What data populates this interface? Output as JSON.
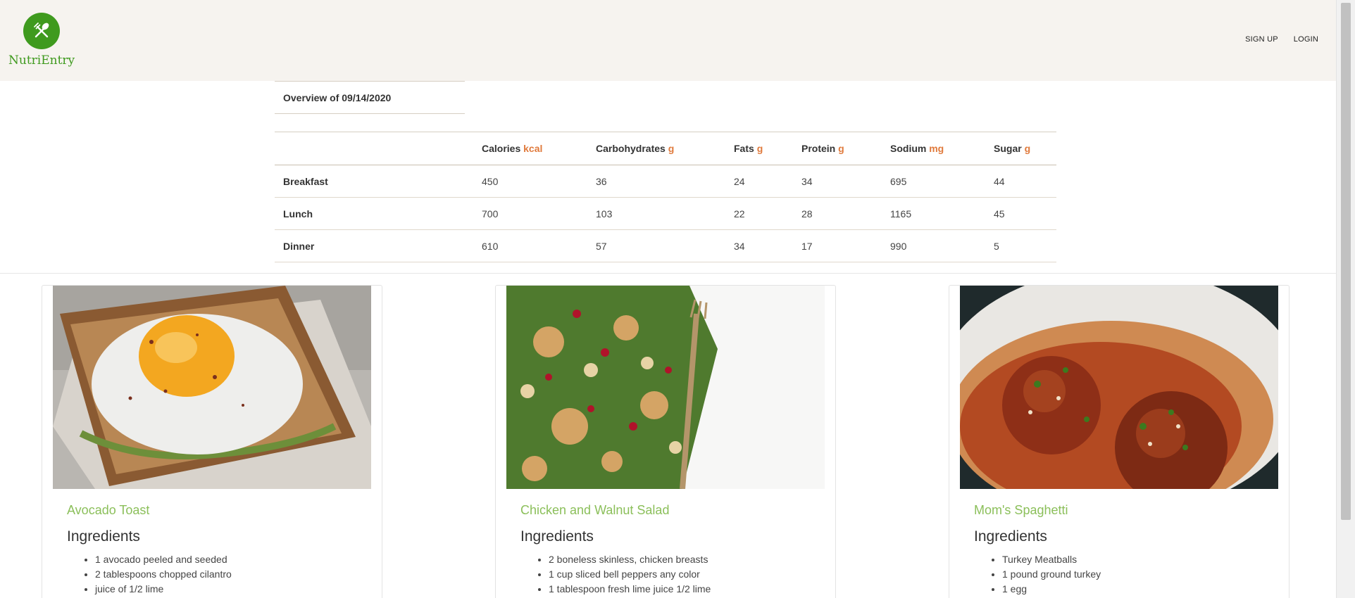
{
  "header": {
    "brand": "NutriEntry",
    "nav": [
      "SIGN UP",
      "LOGIN"
    ]
  },
  "overview": {
    "title": "Overview of 09/14/2020"
  },
  "nutrition_table": {
    "columns": [
      {
        "name": "Calories",
        "unit": "kcal"
      },
      {
        "name": "Carbohydrates",
        "unit": "g"
      },
      {
        "name": "Fats",
        "unit": "g"
      },
      {
        "name": "Protein",
        "unit": "g"
      },
      {
        "name": "Sodium",
        "unit": "mg"
      },
      {
        "name": "Sugar",
        "unit": "g"
      }
    ],
    "rows": [
      {
        "meal": "Breakfast",
        "values": [
          "450",
          "36",
          "24",
          "34",
          "695",
          "44"
        ]
      },
      {
        "meal": "Lunch",
        "values": [
          "700",
          "103",
          "22",
          "28",
          "1165",
          "45"
        ]
      },
      {
        "meal": "Dinner",
        "values": [
          "610",
          "57",
          "34",
          "17",
          "990",
          "5"
        ]
      }
    ]
  },
  "recipes": [
    {
      "title": "Avocado Toast",
      "subtitle": "Ingredients",
      "ingredients": [
        "1 avocado peeled and seeded",
        "2 tablespoons chopped cilantro",
        "juice of 1/2 lime"
      ]
    },
    {
      "title": "Chicken and Walnut Salad",
      "subtitle": "Ingredients",
      "ingredients": [
        "2 boneless skinless, chicken breasts",
        "1 cup sliced bell peppers any color",
        "1 tablespoon fresh lime juice 1/2 lime"
      ]
    },
    {
      "title": "Mom's Spaghetti",
      "subtitle": "Ingredients",
      "ingredients": [
        "Turkey Meatballs",
        "1 pound ground turkey",
        "1 egg"
      ]
    }
  ],
  "colors": {
    "brand": "#3f9a1e",
    "unit": "#e07a3c",
    "recipe_title": "#8bbf5a",
    "header_bg": "#f6f3ef"
  }
}
